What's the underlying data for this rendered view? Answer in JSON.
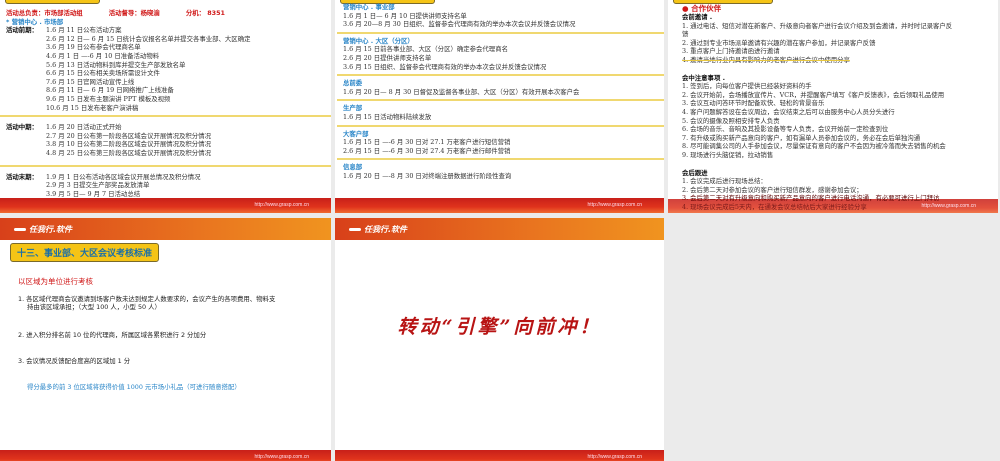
{
  "footer_url": "http://www.grasp.com.cn",
  "logo": "任我行.软件",
  "slide1": {
    "top_line": {
      "leader": "活动总负责：市场部活动组",
      "supervisor": "活动督导：杨晓渝",
      "ext": "分机： 8351"
    },
    "dept": "* 营销中心 . 市场部",
    "sections": [
      {
        "label": "活动前期：",
        "items": [
          "1.6 月 11 日公布活动方案",
          "2.6 月 12 日— 6 月 15 日统计会议报名名单并提交各事业部、大区确定",
          "3.6 月 19 日公布参会代理商名单",
          "4.6 月 1 日 —-6 月 10 日准备活动物料",
          "5.6 月 13 日活动物料到库并提交生产部发放名单",
          "6.6 月 15 日公布相关卖场所需设计文件",
          "7.6 月 15 日官网活动宣传上线",
          "8.6 月 11 日— 6 月 19 日网络推广上线准备",
          "9.6 月 15 日发布主题演讲 PPT 模板及视频",
          "10.6 月 15 日发布老客户演讲稿"
        ]
      },
      {
        "label": "活动中期：",
        "items": [
          "1.6 月 20 日活动正式开始",
          "2.7 月 20 日公布第一阶段各区域会议开展情况及积分情况",
          "3.8 月 10 日公布第二阶段各区域会议开展情况及积分情况",
          "4.8 月 25 日公布第三阶段各区域会议开展情况及积分情况"
        ]
      },
      {
        "label": "活动末期：",
        "items": [
          "1.9 月 1 日公布活动各区域会议开展总情况及积分情况",
          "2.9 月 3 日提交生产部奖品发放清单",
          "3.9 月 5 日— 9 月 7 日活动总结"
        ]
      }
    ]
  },
  "slide2": {
    "sections": [
      {
        "title": "营销中心 . 事业部",
        "items": [
          "1.6 月 1 日— 6 月 10 日提供讲师支持名单",
          "3.6 月 20—8 月 30 日组织、监督参会代理商有效的举办本次会议并反馈会议情况"
        ]
      },
      {
        "title": "营销中心 . 大区（分区）",
        "items": [
          "1.6 月 15 日前各事业部、大区（分区）确定参会代理商名",
          "2.6 月 20 日提供讲师支持名单",
          "3.6 月 15 日组织、监督参会代理商有效的举办本次会议并反馈会议情况"
        ]
      },
      {
        "title": "总前委",
        "items": [
          "1.6 月 20 日— 8 月 30 日督促及监督各事业部、大区（分区）有效开展本次客户会"
        ]
      },
      {
        "title": "生产部",
        "items": [
          "1.6 月 15 日活动物料陆续发放"
        ]
      },
      {
        "title": "大客户部",
        "items": [
          "1.6 月 15 日 —-6 月 30 日对 27.1 万老客户进行短信营销",
          "2.6 月 15 日 —-6 月 30 日对 27.4 万老客户进行邮件营销"
        ]
      },
      {
        "title": "信息部",
        "items": [
          "1.6 月 20 日 —-8 月 30 日对终端注册数据进行阶段性查询"
        ]
      }
    ]
  },
  "slide3": {
    "title": "● 合作伙伴",
    "sections": [
      {
        "title": "会前邀请 .",
        "items": [
          "1. 通过电话、短信对潜在新客户、升级意向者客户进行会议介绍及到会邀请，并时时记录客户反",
          "馈",
          "2. 通过到专业市场派单邀请有兴趣的潜在客户参加，并记录客户反馈",
          "3. 重点客户上门持邀请函进行邀请",
          "4. 邀请当地行业内具有影响力的老客户进行会议中使用分享"
        ]
      },
      {
        "title": "会中注意事项 .",
        "items": [
          "1. 签到后，向每位客户提供已经装好资料的手",
          "2. 会议开始前，会场播放宣传片、VCR，并提醒客户填写《客户反馈表》，会后领取礼品使用",
          "3. 会议互动问答环节时配备欢快、轻松的背景音乐",
          "4. 客户问题解答设在会议周边，会议结束之后可以由服务中心人员分头进行",
          "5. 会议的摄像及照相安排专人负责",
          "6. 会场的音乐、音响及其投影设备等专人负责，会议开始前一定检查到位",
          "7. 有升级或购买新产品意向的客户，如有漏单人员参加会议的，务必在会后单独沟通",
          "8. 尽可能调集公司的人手参加会议，尽量保证有意向的客户不会因为被冷落而失去销售的机会",
          "9. 现场进行头脑促销，拉动销售"
        ]
      },
      {
        "title": "会后跟进",
        "items": [
          "1. 会议完成后进行现场总结：",
          "2. 会后第二天对参加会议的客户进行短信群发，感谢参加会议；",
          "3. 会后第二天对有升级意向和购买新产品意向的客户进行电话沟通，有必要可进行上门拜访",
          "4. 现场会议完成后5天内，在通发会议总结帖后大家进行经验分享"
        ]
      }
    ]
  },
  "slide4": {
    "title": "十三、事业部、大区会议考核标准",
    "subtitle": "以区域为单位进行考核",
    "items": [
      "1. 各区域代理商会议邀请到场客户数未达到规定人数要求的，会议产生的各项费用、物料支",
      "持由该区域承担；（大型 100 人，小型 50 人）",
      "2. 进入积分排名前 10 位的代理商，所属区域各累积进行 2 分加分",
      "3. 会议情况反馈配合度高的区域加 1 分"
    ],
    "note": "得分最多的前 3 位区域将获得价值 1000 元市场小礼品（可进行随意搭配）"
  },
  "slide5": {
    "slogan": "转动“引擎”向前冲！"
  }
}
